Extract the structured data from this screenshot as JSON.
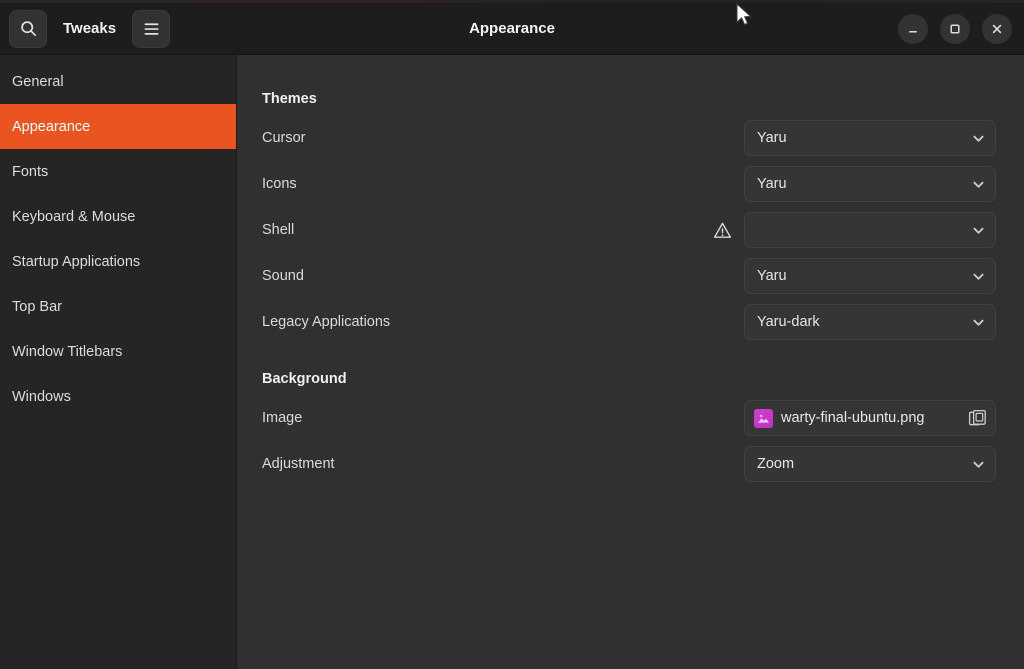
{
  "window": {
    "app_title": "Tweaks",
    "title": "Appearance",
    "search_icon": "search-icon",
    "menu_icon": "hamburger-menu-icon",
    "controls": {
      "minimize": "minimize-icon",
      "maximize": "maximize-icon",
      "close": "close-icon"
    }
  },
  "sidebar": {
    "items": [
      {
        "label": "General",
        "selected": false
      },
      {
        "label": "Appearance",
        "selected": true
      },
      {
        "label": "Fonts",
        "selected": false
      },
      {
        "label": "Keyboard & Mouse",
        "selected": false
      },
      {
        "label": "Startup Applications",
        "selected": false
      },
      {
        "label": "Top Bar",
        "selected": false
      },
      {
        "label": "Window Titlebars",
        "selected": false
      },
      {
        "label": "Windows",
        "selected": false
      }
    ]
  },
  "main": {
    "sections": [
      {
        "title": "Themes",
        "rows": [
          {
            "label": "Cursor",
            "value": "Yaru",
            "control": "combo",
            "warning": false
          },
          {
            "label": "Icons",
            "value": "Yaru",
            "control": "combo",
            "warning": false
          },
          {
            "label": "Shell",
            "value": "",
            "control": "combo",
            "warning": true
          },
          {
            "label": "Sound",
            "value": "Yaru",
            "control": "combo",
            "warning": false
          },
          {
            "label": "Legacy Applications",
            "value": "Yaru-dark",
            "control": "combo",
            "warning": false
          }
        ]
      },
      {
        "title": "Background",
        "rows": [
          {
            "label": "Image",
            "value": "warty-final-ubuntu.png",
            "control": "file",
            "warning": false
          },
          {
            "label": "Adjustment",
            "value": "Zoom",
            "control": "combo",
            "warning": false
          }
        ]
      }
    ]
  },
  "icons": {
    "warning": "warning-triangle-icon",
    "chevron": "chevron-down-icon",
    "thumbnail": "image-thumbnail-icon",
    "file_chooser": "documents-stack-icon",
    "pointer": "mouse-pointer-icon"
  },
  "colors": {
    "accent": "#e95420",
    "headerbar": "#1d1d1d",
    "sidebar": "#252525",
    "panel": "#303030",
    "control": "#353535",
    "text": "#dadada",
    "thumbnail": "#c833c8"
  }
}
